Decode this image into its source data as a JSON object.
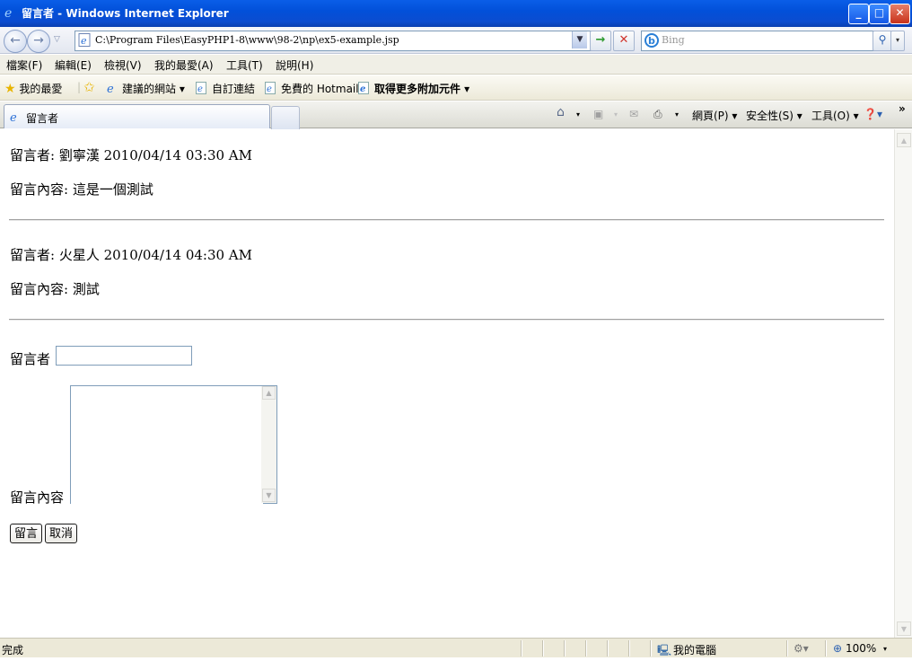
{
  "window": {
    "title": "留言者 - Windows Internet Explorer"
  },
  "address": {
    "url": "C:\\Program Files\\EasyPHP1-8\\www\\98-2\\np\\ex5-example.jsp"
  },
  "search": {
    "placeholder": "Bing"
  },
  "menu": [
    "檔案(F)",
    "編輯(E)",
    "檢視(V)",
    "我的最愛(A)",
    "工具(T)",
    "說明(H)"
  ],
  "favorites": {
    "label": "我的最愛",
    "items": [
      "建議的網站 ▾",
      "自訂連結",
      "免費的 Hotmail",
      "取得更多附加元件 ▾"
    ]
  },
  "tab": {
    "title": "留言者"
  },
  "commandbar": {
    "page": "網頁(P) ▾",
    "safety": "安全性(S) ▾",
    "tools": "工具(O) ▾",
    "more": "»"
  },
  "messages": [
    {
      "author_line": "留言者: 劉寧漢 2010/04/14 03:30 AM",
      "content_line": "留言內容: 這是一個測試"
    },
    {
      "author_line": "留言者: 火星人 2010/04/14 04:30 AM",
      "content_line": "留言內容: 測試"
    }
  ],
  "form": {
    "name_label": "留言者",
    "name_value": "",
    "content_label": "留言內容",
    "submit_label": "留言",
    "cancel_label": "取消"
  },
  "status": {
    "text": "完成",
    "zone": "我的電腦",
    "zoom": "100%"
  },
  "colors": {
    "titlebar": "#0250d9",
    "chrome": "#ece9d8",
    "link_border": "#7f9db9"
  }
}
